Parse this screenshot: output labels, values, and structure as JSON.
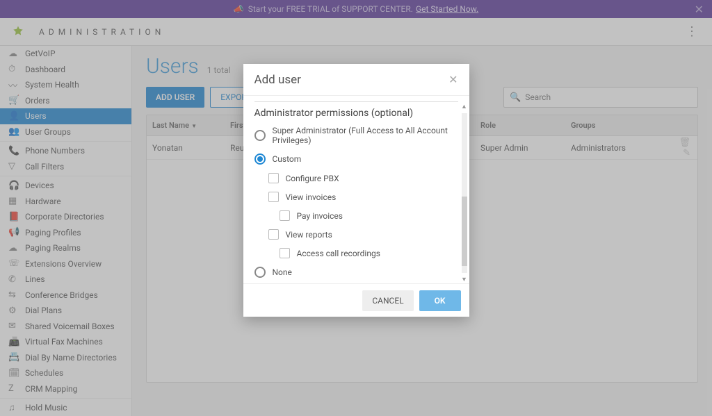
{
  "banner": {
    "text": "Start your FREE TRIAL of SUPPORT CENTER.",
    "link": "Get Started Now."
  },
  "topbar": {
    "title": "ADMINISTRATION"
  },
  "sidebar": {
    "items": [
      {
        "icon": "cloud",
        "label": "GetVoIP"
      },
      {
        "icon": "gauge",
        "label": "Dashboard"
      },
      {
        "icon": "pulse",
        "label": "System Health"
      },
      {
        "icon": "cart",
        "label": "Orders"
      },
      {
        "icon": "user",
        "label": "Users"
      },
      {
        "icon": "users",
        "label": "User Groups"
      },
      {
        "icon": "phone",
        "label": "Phone Numbers"
      },
      {
        "icon": "filter",
        "label": "Call Filters"
      },
      {
        "icon": "headset",
        "label": "Devices"
      },
      {
        "icon": "hardware",
        "label": "Hardware"
      },
      {
        "icon": "book",
        "label": "Corporate Directories"
      },
      {
        "icon": "megaphone",
        "label": "Paging Profiles"
      },
      {
        "icon": "cloud2",
        "label": "Paging Realms"
      },
      {
        "icon": "ext",
        "label": "Extensions Overview"
      },
      {
        "icon": "phone2",
        "label": "Lines"
      },
      {
        "icon": "bridge",
        "label": "Conference Bridges"
      },
      {
        "icon": "dial",
        "label": "Dial Plans"
      },
      {
        "icon": "vm",
        "label": "Shared Voicemail Boxes"
      },
      {
        "icon": "fax",
        "label": "Virtual Fax Machines"
      },
      {
        "icon": "dir",
        "label": "Dial By Name Directories"
      },
      {
        "icon": "sched",
        "label": "Schedules"
      },
      {
        "icon": "crm",
        "label": "CRM Mapping"
      },
      {
        "icon": "music",
        "label": "Hold Music"
      }
    ]
  },
  "page": {
    "title": "Users",
    "count": "1 total",
    "add_btn": "ADD USER",
    "export_btn": "EXPORT TO C",
    "search_placeholder": "Search"
  },
  "table": {
    "cols": {
      "last": "Last Name",
      "first": "First",
      "role": "Role",
      "groups": "Groups"
    },
    "rows": [
      {
        "last": "Yonatan",
        "first": "Reu",
        "role": "Super Admin",
        "groups": "Administrators"
      }
    ]
  },
  "modal": {
    "title": "Add user",
    "section": "Administrator permissions (optional)",
    "opts": {
      "super": "Super Administrator (Full Access to All Account Privileges)",
      "custom": "Custom",
      "none": "None"
    },
    "checks": {
      "pbx": "Configure PBX",
      "inv": "View invoices",
      "pay": "Pay invoices",
      "rep": "View reports",
      "rec": "Access call recordings"
    },
    "cancel": "CANCEL",
    "ok": "OK"
  }
}
